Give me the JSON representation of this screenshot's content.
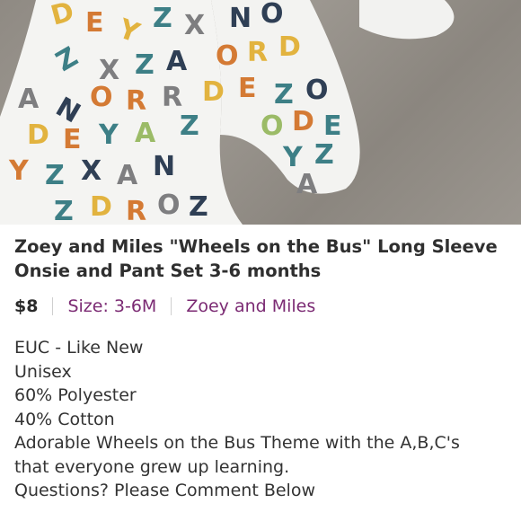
{
  "listing": {
    "photo_alt": "",
    "title": "Zoey and Miles \"Wheels on the Bus\" Long Sleeve Onsie and Pant Set 3-6 months",
    "price": "$8",
    "size": "Size: 3-6M",
    "brand": "Zoey and Miles",
    "description_lines": [
      "EUC - Like New",
      "Unisex",
      "60% Polyester",
      "40% Cotton",
      "Adorable Wheels on the Bus Theme with the A,B,C's",
      "that everyone grew up learning.",
      "Questions? Please Comment Below"
    ]
  },
  "colors": {
    "carpet": "#9a958e",
    "fabric": "#f4f4f2",
    "letter_orange": "#d47a34",
    "letter_yellow": "#e2b33f",
    "letter_teal": "#3d7f86",
    "letter_gray": "#7e7e80",
    "letter_navy": "#2f3f55",
    "letter_green": "#9bbb67",
    "accent_purple": "#7b2a73"
  }
}
